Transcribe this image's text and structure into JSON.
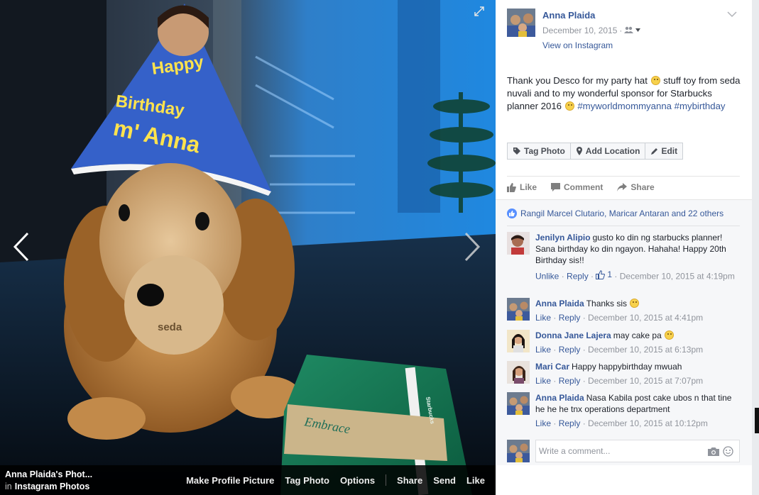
{
  "photo": {
    "album_owner_title": "Anna Plaida's Phot...",
    "album_prefix": "in",
    "album_name": "Instagram Photos",
    "actions": [
      "Make Profile Picture",
      "Tag Photo",
      "Options",
      "Share",
      "Send",
      "Like"
    ],
    "hat_text": [
      "Happy",
      "Birthday",
      "m' Anna"
    ],
    "bag_text": "seda",
    "notebook_text": "Starbucks"
  },
  "post": {
    "author": "Anna Plaida",
    "date": "December 10, 2015",
    "dot": "·",
    "view_link": "View on Instagram",
    "text_part1": "Thank you Desco for my party hat ",
    "text_part2": " stuff toy from seda nuvali and to my wonderful sponsor for Starbucks planner 2016 ",
    "hashtag1": "#myworldmommyanna",
    "hashtag2": "#mybirthday",
    "buttons": {
      "tag_photo": "Tag Photo",
      "add_location": "Add Location",
      "edit": "Edit"
    },
    "actions": {
      "like": "Like",
      "comment": "Comment",
      "share": "Share"
    },
    "likes_summary": "Rangil Marcel Clutario, Maricar Antaran and 22 others"
  },
  "comments": [
    {
      "name": "Jenilyn Alipio",
      "text": "gusto ko din ng starbucks planner! Sana birthday ko din ngayon. Hahaha! Happy 20th Birthday sis!!",
      "action1": "Unlike",
      "reply": "Reply",
      "like_count": "1",
      "time": "December 10, 2015 at 4:19pm"
    },
    {
      "name": "Anna Plaida",
      "text": "Thanks sis",
      "action1": "Like",
      "reply": "Reply",
      "time": "December 10, 2015 at 4:41pm"
    },
    {
      "name": "Donna Jane Lajera",
      "text": "may cake pa",
      "action1": "Like",
      "reply": "Reply",
      "time": "December 10, 2015 at 6:13pm"
    },
    {
      "name": "Mari Car",
      "text": "Happy happybirthday mwuah",
      "action1": "Like",
      "reply": "Reply",
      "time": "December 10, 2015 at 7:07pm"
    },
    {
      "name": "Anna Plaida",
      "text": "Nasa Kabila post cake ubos n that tine he he he tnx operations department",
      "action1": "Like",
      "reply": "Reply",
      "time": "December 10, 2015 at 10:12pm"
    }
  ],
  "composer": {
    "placeholder": "Write a comment..."
  },
  "colors": {
    "link": "#365899",
    "meta": "#90949c",
    "like_blue": "#5890ff"
  }
}
